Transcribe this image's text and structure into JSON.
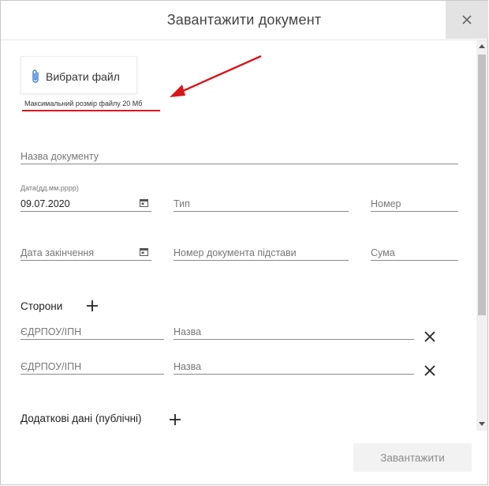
{
  "dialog": {
    "title": "Завантажити документ"
  },
  "file_picker": {
    "button_label": "Вибрати файл",
    "max_size_note": "Максимальний розмір файлу 20 Мб"
  },
  "form": {
    "doc_name_placeholder": "Назва документу",
    "date_label": "Дата(дд.мм.рррр)",
    "date_value": "09.07.2020",
    "type_placeholder": "Тип",
    "number_placeholder": "Номер",
    "end_date_placeholder": "Дата закінчення",
    "base_doc_number_placeholder": "Номер документа підстави",
    "sum_placeholder": "Сума"
  },
  "parties": {
    "label": "Сторони",
    "rows": [
      {
        "edrpou_placeholder": "ЄДРПОУ/ІПН",
        "name_placeholder": "Назва"
      },
      {
        "edrpou_placeholder": "ЄДРПОУ/ІПН",
        "name_placeholder": "Назва"
      }
    ]
  },
  "extra": {
    "label": "Додаткові дані (публічні)"
  },
  "footer": {
    "upload_label": "Завантажити"
  },
  "icons": {
    "close": "close-icon",
    "clip": "paperclip-icon",
    "calendar": "calendar-icon",
    "plus": "plus-icon",
    "remove": "remove-x-icon"
  },
  "colors": {
    "annotation_red": "#d9161c",
    "clip_blue": "#3a7bd5",
    "close_bg": "#e3e3e3"
  }
}
